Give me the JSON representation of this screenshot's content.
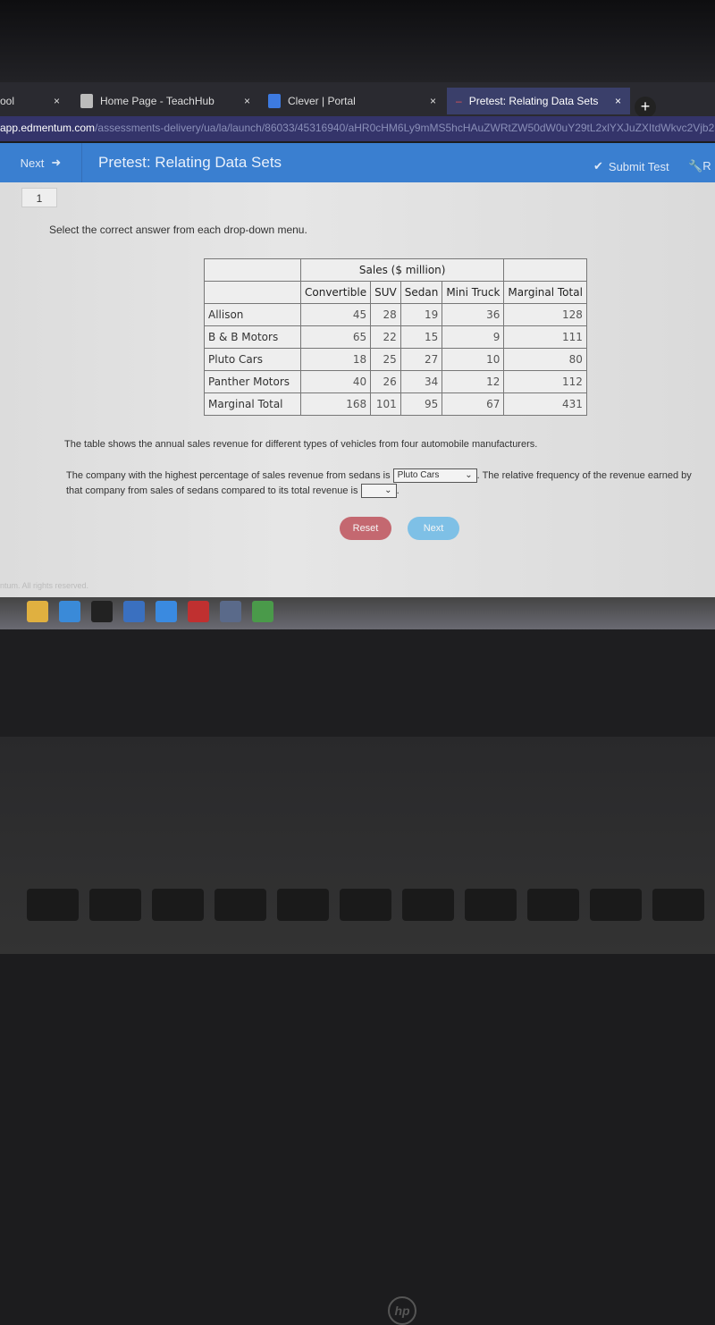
{
  "browser": {
    "tabs": [
      {
        "label": "ool",
        "active": false
      },
      {
        "label": "Home Page - TeachHub",
        "active": false
      },
      {
        "label": "Clever | Portal",
        "active": false
      },
      {
        "label": "Pretest: Relating Data Sets",
        "active": true
      }
    ],
    "close_glyph": "×",
    "new_tab_glyph": "+",
    "url_host": "app.edmentum.com",
    "url_path": "/assessments-delivery/ua/la/launch/86033/45316940/aHR0cHM6Ly9mMS5hcHAuZWRtZW50dW0uY29tL2xlYXJuZXItdWkvc2Vjb25"
  },
  "appbar": {
    "next_label": "Next",
    "title": "Pretest: Relating Data Sets",
    "submit_label": "Submit Test",
    "right_label": "R",
    "color": "#3a7fd0"
  },
  "question": {
    "number": "1",
    "instruction": "Select the correct answer from each drop-down menu.",
    "table": {
      "group_header": "Sales ($ million)",
      "columns": [
        "Convertible",
        "SUV",
        "Sedan",
        "Mini Truck",
        "Marginal Total"
      ],
      "rows": [
        {
          "name": "Allison",
          "values": [
            "45",
            "28",
            "19",
            "36",
            "128"
          ]
        },
        {
          "name": "B & B Motors",
          "values": [
            "65",
            "22",
            "15",
            "9",
            "111"
          ]
        },
        {
          "name": "Pluto Cars",
          "values": [
            "18",
            "25",
            "27",
            "10",
            "80"
          ]
        },
        {
          "name": "Panther Motors",
          "values": [
            "40",
            "26",
            "34",
            "12",
            "112"
          ]
        },
        {
          "name": "Marginal Total",
          "values": [
            "168",
            "101",
            "95",
            "67",
            "431"
          ]
        }
      ]
    },
    "description": "The table shows the annual sales revenue for different types of vehicles from four automobile manufacturers.",
    "text_part1": "The company with the highest percentage of sales revenue from sedans is",
    "dropdown1_value": "Pluto Cars",
    "text_part2": ". The relative frequency of the revenue earned by that company from sales of sedans compared to its total revenue is",
    "dropdown2_value": "",
    "text_part3": ".",
    "reset_label": "Reset",
    "next_label": "Next"
  },
  "footer": "ntum. All rights reserved.",
  "laptop_logo": "hp"
}
